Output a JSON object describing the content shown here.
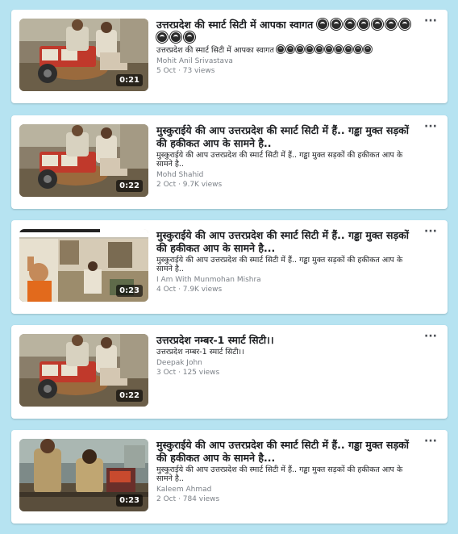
{
  "videos": [
    {
      "title": "उत्तरप्रदेश की स्मार्ट सिटी में आपका स्वागत",
      "title_emoji_count": 10,
      "description": "उत्तरप्रदेश की स्मार्ट सिटी में आपका स्वागत",
      "desc_emoji_count": 10,
      "author": "Mohit Anil Srivastava",
      "meta": "5 Oct · 73 views",
      "duration": "0:21",
      "thumb": "cart"
    },
    {
      "title": "मुस्कुराईये की आप उत्तरप्रदेश की स्मार्ट सिटी में हैं.. गड्ढा मुक्त सड़कों की हकीकत आप के सामने है..",
      "description": "मुस्कुराईये की आप उत्तरप्रदेश की स्मार्ट सिटी में हैं.. गड्ढा मुक्त सड़कों की हकीकत आप के सामने है..",
      "author": "Mohd Shahid",
      "meta": "2 Oct · 9.7K views",
      "duration": "0:22",
      "thumb": "cart"
    },
    {
      "title": "मुस्कुराईये की आप उत्तरप्रदेश की स्मार्ट सिटी में हैं.. गड्ढा मुक्त सड़कों की हकीकत आप के सामने है...",
      "description": "मुस्कुराईये की आप उत्तरप्रदेश की स्मार्ट सिटी में हैं.. गड्ढा मुक्त सड़कों की हकीकत आप के सामने है..",
      "author": "I Am With Munmohan Mishra",
      "meta": "4 Oct · 7.9K views",
      "duration": "0:23",
      "thumb": "street"
    },
    {
      "title": "उत्तरप्रदेश नम्बर-1 स्मार्ट सिटी।।",
      "description": "उत्तरप्रदेश नम्बर-1 स्मार्ट सिटी।।",
      "author": "Deepak John",
      "meta": "3 Oct · 125 views",
      "duration": "0:22",
      "thumb": "cart"
    },
    {
      "title": "मुस्कुराईये की आप उत्तरप्रदेश की स्मार्ट सिटी में हैं.. गड्ढा मुक्त सड़कों की हकीकत आप के सामने है...",
      "description": "मुस्कुराईये की आप उत्तरप्रदेश की स्मार्ट सिटी में हैं.. गड्ढा मुक्त सड़कों की हकीकत आप के सामने है..",
      "author": "Kaleem Ahmad",
      "meta": "2 Oct · 784 views",
      "duration": "0:23",
      "thumb": "police"
    }
  ],
  "more_icon": "more-horizontal-icon",
  "colors": {
    "background": "#b6e3f1",
    "card": "#ffffff",
    "title": "#1c1e21",
    "secondary": "#7b8087"
  }
}
